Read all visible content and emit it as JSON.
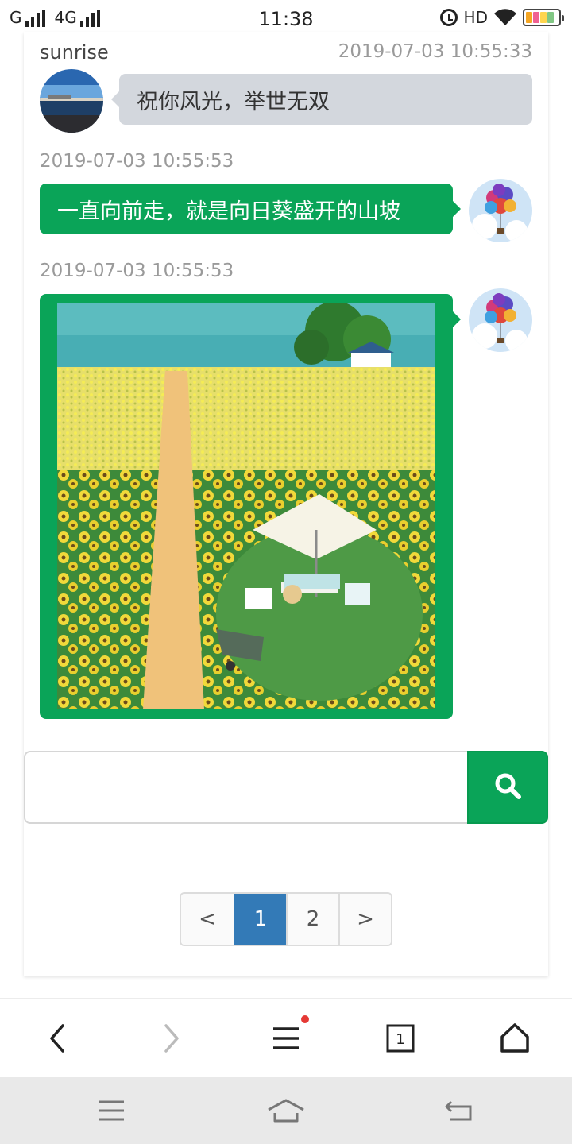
{
  "status_bar": {
    "carrier1": "G",
    "carrier2": "4G",
    "time": "11:38",
    "hd": "HD",
    "icons": [
      "signal-icon",
      "alarm-icon",
      "wifi-icon",
      "battery-icon"
    ]
  },
  "chat": {
    "messages": [
      {
        "sender": "sunrise",
        "timestamp": "2019-07-03 10:55:33",
        "text": "祝你风光，举世无双",
        "side": "left"
      },
      {
        "sender": "",
        "timestamp": "2019-07-03 10:55:53",
        "text": "一直向前走，就是向日葵盛开的山坡",
        "side": "right"
      },
      {
        "sender": "",
        "timestamp": "2019-07-03 10:55:53",
        "image": "sunflower-field-photo",
        "side": "right"
      }
    ]
  },
  "search": {
    "value": "",
    "placeholder": "",
    "button_icon": "search-icon"
  },
  "pagination": {
    "prev": "<",
    "pages": [
      "1",
      "2"
    ],
    "active": "1",
    "next": ">"
  },
  "browser_toolbar": {
    "icons": [
      "back-icon",
      "forward-icon",
      "menu-icon",
      "tabs-icon",
      "home-icon"
    ],
    "tab_count": "1"
  },
  "system_nav": {
    "icons": [
      "recents-icon",
      "home-icon",
      "back-icon"
    ]
  },
  "colors": {
    "accent_green": "#0aa458",
    "active_page": "#337ab7",
    "received_bubble": "#d3d7dd"
  }
}
